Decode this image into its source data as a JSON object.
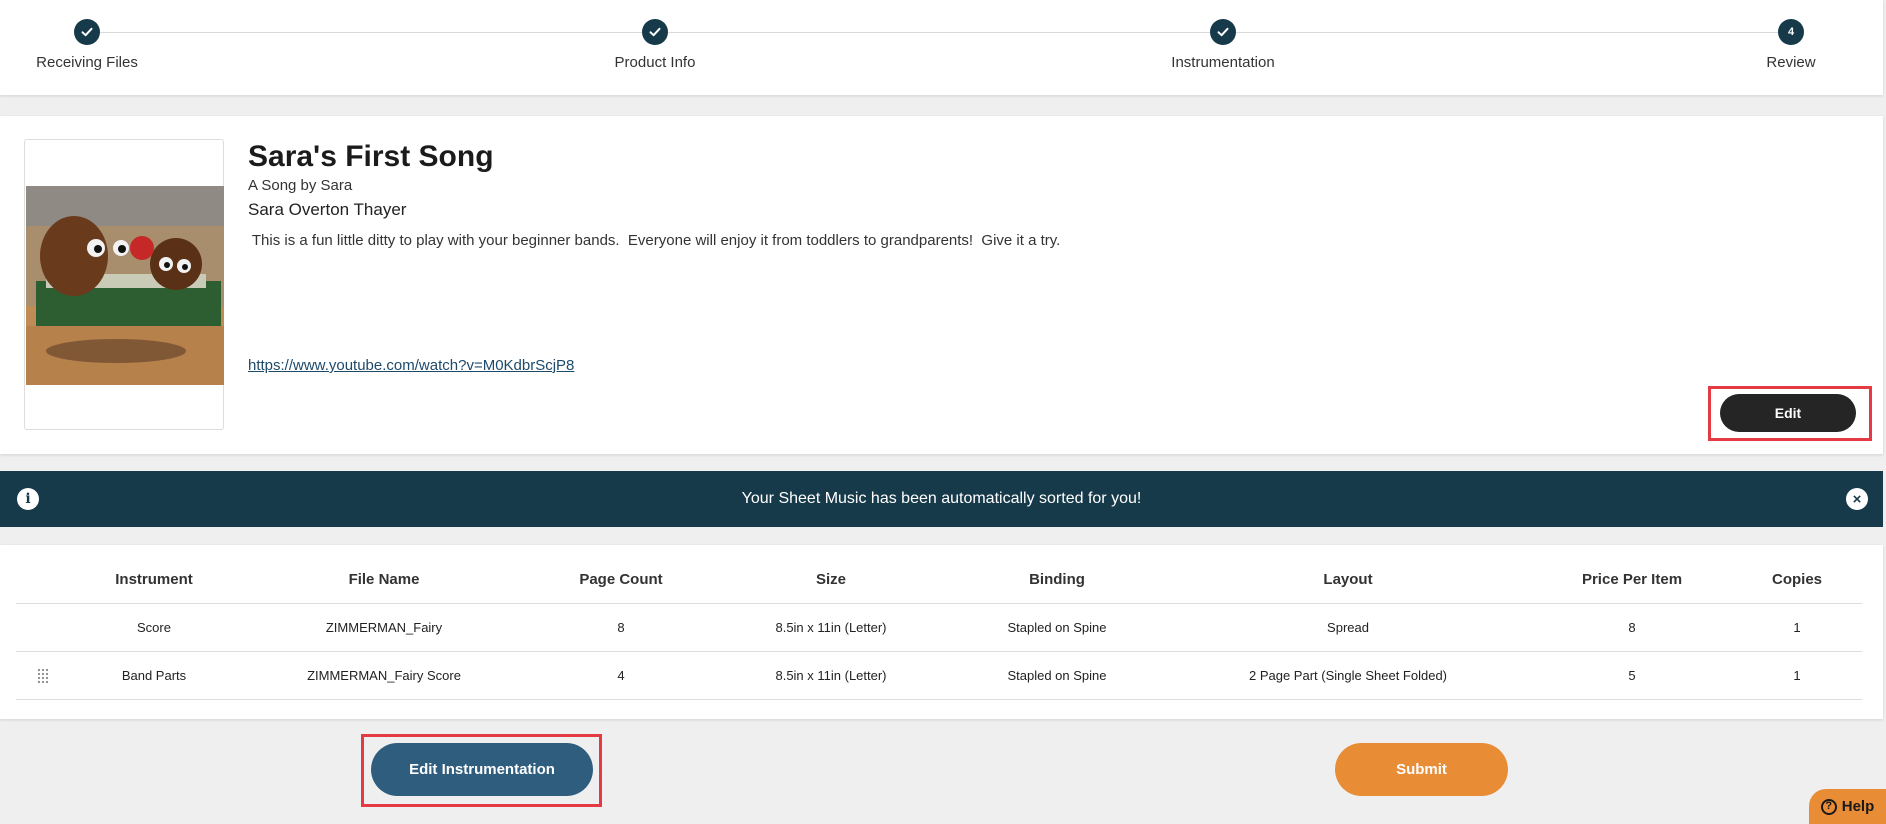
{
  "colors": {
    "primary_dark": "#173a4a",
    "accent_orange": "#e98c36",
    "button_blue": "#2f5d7e",
    "highlight_red": "#e53a44"
  },
  "stepper": {
    "steps": [
      {
        "label": "Receiving Files",
        "state": "complete",
        "icon": "check-icon"
      },
      {
        "label": "Product Info",
        "state": "complete",
        "icon": "check-icon"
      },
      {
        "label": "Instrumentation",
        "state": "complete",
        "icon": "check-icon"
      },
      {
        "label": "Review",
        "state": "current",
        "number": "4"
      }
    ]
  },
  "product": {
    "title": "Sara's First Song",
    "subtitle": "A Song by Sara",
    "composer": "Sara Overton Thayer",
    "description": " This is a fun little ditty to play with your beginner bands.  Everyone will enjoy it from toddlers to grandparents!  Give it a try.",
    "link": "https://www.youtube.com/watch?v=M0KdbrScjP8",
    "edit_label": "Edit"
  },
  "banner": {
    "message": "Your Sheet Music has been automatically sorted for you!",
    "info_icon": "info-icon",
    "close_icon": "close-icon"
  },
  "table": {
    "headers": [
      "Instrument",
      "File Name",
      "Page Count",
      "Size",
      "Binding",
      "Layout",
      "Price Per Item",
      "Copies"
    ],
    "rows": [
      [
        "Score",
        "ZIMMERMAN_Fairy",
        "8",
        "8.5in x 11in (Letter)",
        "Stapled on Spine",
        "Spread",
        "8",
        "1"
      ],
      [
        "Band Parts",
        "ZIMMERMAN_Fairy Score",
        "4",
        "8.5in x 11in (Letter)",
        "Stapled on Spine",
        "2 Page Part (Single Sheet Folded)",
        "5",
        "1"
      ]
    ]
  },
  "actions": {
    "edit_instrumentation": "Edit Instrumentation",
    "submit": "Submit",
    "help": "Help"
  }
}
